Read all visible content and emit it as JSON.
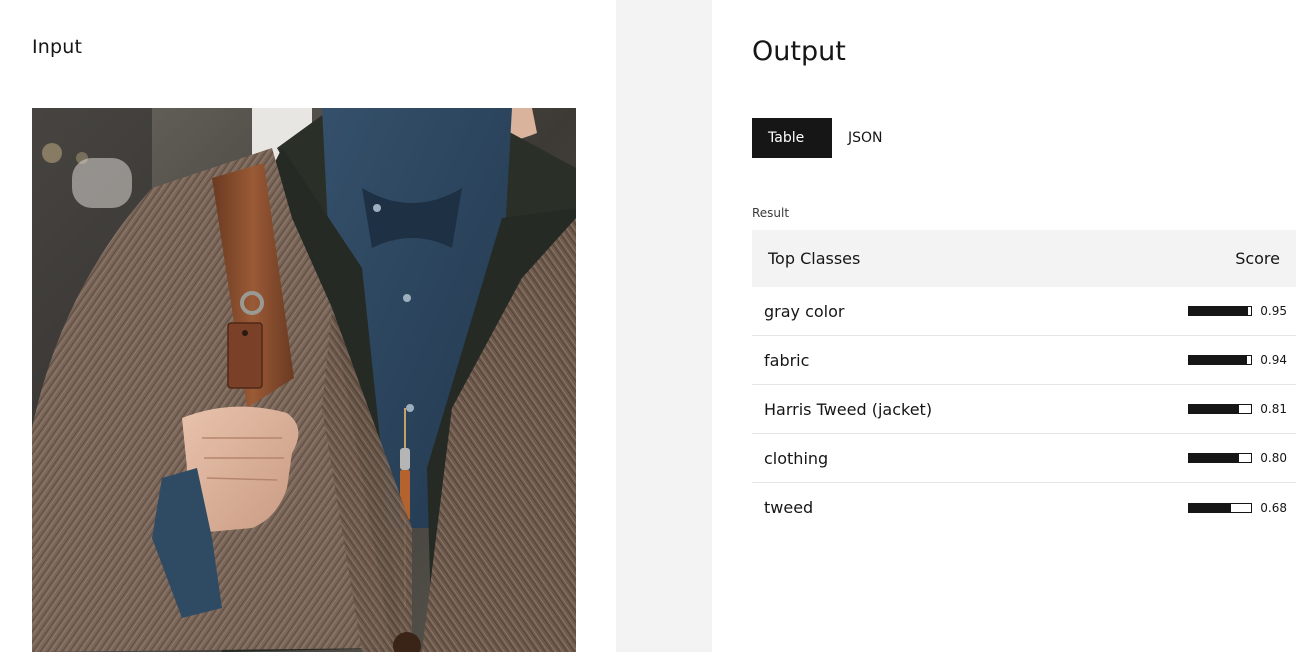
{
  "input": {
    "title": "Input"
  },
  "output": {
    "title": "Output",
    "tabs": [
      {
        "label": "Table",
        "active": true
      },
      {
        "label": "JSON",
        "active": false
      }
    ],
    "result_label": "Result",
    "table": {
      "headers": {
        "class": "Top Classes",
        "score": "Score"
      },
      "rows": [
        {
          "class": "gray color",
          "score": 0.95,
          "score_text": "0.95"
        },
        {
          "class": "fabric",
          "score": 0.94,
          "score_text": "0.94"
        },
        {
          "class": "Harris Tweed (jacket)",
          "score": 0.81,
          "score_text": "0.81"
        },
        {
          "class": "clothing",
          "score": 0.8,
          "score_text": "0.80"
        },
        {
          "class": "tweed",
          "score": 0.68,
          "score_text": "0.68"
        }
      ]
    }
  },
  "colors": {
    "accent": "#161616",
    "gutter": "#f3f3f3",
    "header_bg": "#f3f3f3"
  }
}
